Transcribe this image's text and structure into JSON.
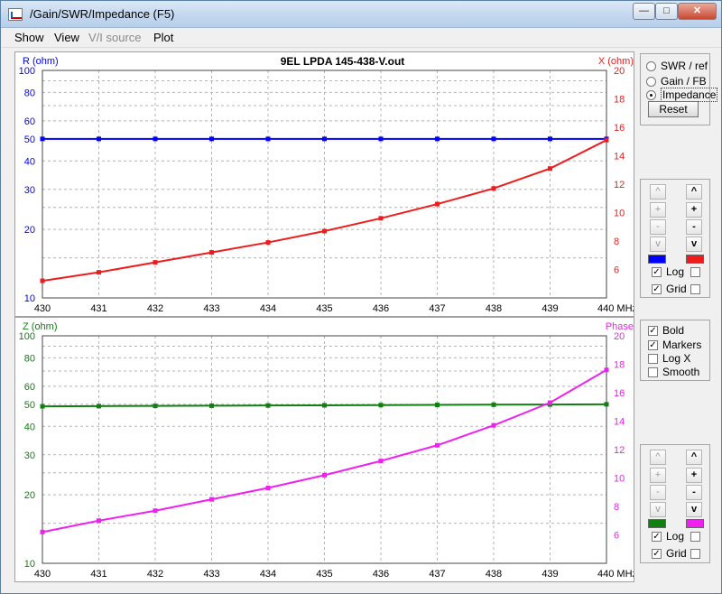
{
  "window": {
    "title": "/Gain/SWR/Impedance (F5)",
    "buttons": {
      "minimize": "—",
      "maximize": "□",
      "close": "✕"
    }
  },
  "menu": [
    {
      "label": "Show",
      "enabled": true
    },
    {
      "label": "View",
      "enabled": true
    },
    {
      "label": "V/I source",
      "enabled": false
    },
    {
      "label": "Plot",
      "enabled": true
    }
  ],
  "colors": {
    "r_series": "#0000ff",
    "x_series": "#ee1c1c",
    "z_series": "#108010",
    "phase_series": "#f020f0",
    "grid": "#b4b4b4"
  },
  "chart_data": [
    {
      "type": "line",
      "title": "9EL LPDA 145-438-V.out",
      "ylabel": "R (ohm)",
      "y2label": "X (ohm)",
      "x": [
        430,
        431,
        432,
        433,
        434,
        435,
        436,
        437,
        438,
        439,
        440
      ],
      "xtick_labels": [
        "430",
        "431",
        "432",
        "433",
        "434",
        "435",
        "436",
        "437",
        "438",
        "439",
        "440 MHz"
      ],
      "xlim": [
        430,
        440
      ],
      "ylim": [
        10,
        100
      ],
      "y_scale": "log",
      "yticks": [
        10,
        20,
        30,
        40,
        50,
        60,
        80,
        100
      ],
      "y2lim": [
        4,
        20
      ],
      "y2ticks": [
        6,
        8,
        10,
        12,
        14,
        16,
        18,
        20
      ],
      "grid": true,
      "series": [
        {
          "axis": "left",
          "values": [
            50,
            50,
            50,
            50,
            50,
            50,
            50,
            50,
            50,
            50,
            50
          ]
        },
        {
          "axis": "right",
          "values": [
            5.2,
            5.8,
            6.5,
            7.2,
            7.9,
            8.7,
            9.6,
            10.6,
            11.7,
            13.1,
            15.1
          ]
        }
      ]
    },
    {
      "type": "line",
      "title": "",
      "ylabel": "Z (ohm)",
      "y2label": "Phase",
      "x": [
        430,
        431,
        432,
        433,
        434,
        435,
        436,
        437,
        438,
        439,
        440
      ],
      "xtick_labels": [
        "430",
        "431",
        "432",
        "433",
        "434",
        "435",
        "436",
        "437",
        "438",
        "439",
        "440 MHz"
      ],
      "xlim": [
        430,
        440
      ],
      "ylim": [
        10,
        100
      ],
      "y_scale": "log",
      "yticks": [
        10,
        20,
        30,
        40,
        50,
        60,
        80,
        100
      ],
      "y2lim": [
        4,
        20
      ],
      "y2ticks": [
        6,
        8,
        10,
        12,
        14,
        16,
        18,
        20
      ],
      "grid": true,
      "series": [
        {
          "axis": "left",
          "values": [
            49.0,
            49.1,
            49.2,
            49.3,
            49.4,
            49.5,
            49.6,
            49.7,
            49.8,
            49.9,
            50.0
          ]
        },
        {
          "axis": "right",
          "values": [
            6.2,
            7.0,
            7.7,
            8.5,
            9.3,
            10.2,
            11.2,
            12.3,
            13.7,
            15.3,
            17.6
          ]
        }
      ]
    }
  ],
  "side": {
    "mode": {
      "options": [
        "SWR / ref",
        "Gain / FB",
        "Impedance"
      ],
      "selected": "Impedance",
      "reset": "Reset"
    },
    "top_scale": {
      "up": "^",
      "plus": "+",
      "minus": "-",
      "down": "v",
      "log_label": "Log",
      "grid_label": "Grid",
      "log_left": true,
      "log_right": false,
      "grid_left": true,
      "grid_right": false
    },
    "options": [
      {
        "label": "Bold",
        "checked": true
      },
      {
        "label": "Markers",
        "checked": true
      },
      {
        "label": "Log X",
        "checked": false
      },
      {
        "label": "Smooth",
        "checked": false
      }
    ],
    "bottom_scale": {
      "up": "^",
      "plus": "+",
      "minus": "-",
      "down": "v",
      "log_label": "Log",
      "grid_label": "Grid",
      "log_left": true,
      "log_right": false,
      "grid_left": true,
      "grid_right": false
    }
  }
}
